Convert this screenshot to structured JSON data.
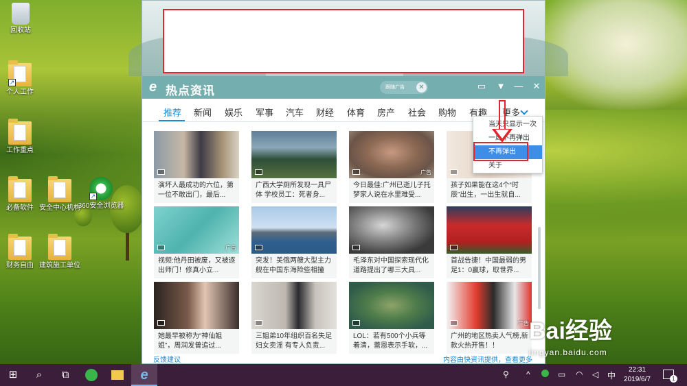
{
  "desktop": {
    "icons": [
      {
        "label": "回收站"
      },
      {
        "label": "个人工作"
      },
      {
        "label": "工作重点"
      },
      {
        "label": "必备软件"
      },
      {
        "label": "安全中心机构"
      },
      {
        "label": "360安全浏览器"
      },
      {
        "label": "财务自由"
      },
      {
        "label": "建筑施工单位"
      }
    ]
  },
  "popup": {
    "app_title": "热点资讯",
    "ad_tag": "跟随广告",
    "window_controls": [
      "monitor-icon",
      "chevron-down-icon",
      "minimize-icon",
      "close-icon"
    ],
    "tabs": [
      "推荐",
      "新闻",
      "娱乐",
      "军事",
      "汽车",
      "财经",
      "体育",
      "房产",
      "社会",
      "购物",
      "有趣",
      "更多"
    ],
    "active_tab": "推荐",
    "cards": [
      {
        "caption": "演坏人最成功的六位，第一位不敢出门，最后...",
        "ad": ""
      },
      {
        "caption": "广西大学厕所发现一具尸体 学校员工：死者身...",
        "ad": ""
      },
      {
        "caption": "今日最佳:广州已逝儿子托梦家人说在水里难受...",
        "ad": "广告"
      },
      {
        "caption": "孩子如果能在这4个“时辰”出生，一出生就自...",
        "ad": ""
      },
      {
        "caption": "视频:他丹田被废，又被逐出师门！修真小立...",
        "ad": "广告"
      },
      {
        "caption": "突发！美俄两艘大型主力舰在中国东海险些相撞",
        "ad": ""
      },
      {
        "caption": "毛泽东对中国探索现代化道路提出了哪三大具...",
        "ad": ""
      },
      {
        "caption": "首战告捷！中国最弱的男足1：0赢球，取世界...",
        "ad": ""
      },
      {
        "caption": "她最早被称为“神仙姐姐”，周润发曾追过...",
        "ad": ""
      },
      {
        "caption": "三姐弟10年组织百名失足妇女卖淫 有专人负责...",
        "ad": ""
      },
      {
        "caption": "LOL：若有500个小兵等着清，蕾恩表示手软，...",
        "ad": ""
      },
      {
        "caption": "广州的地区热卖人气榜,新款火热开售！！",
        "ad": "广告"
      }
    ],
    "footer_left": "反馈建议",
    "footer_right": "内容由快资讯提供，查看更多",
    "menu": [
      "当天只显示一次",
      "一周不再弹出",
      "不再弹出",
      "关于"
    ],
    "menu_selected": "不再弹出",
    "accent": "#1b8ad2",
    "titlebar_color": "#74aeaf",
    "annotation_color": "#e0262a"
  },
  "taskbar": {
    "ime": "中",
    "time": "22:31",
    "date": "2019/6/7",
    "notifications": "1"
  },
  "watermark": {
    "logo": "Bai经验",
    "url": "jingyan.baidu.com"
  }
}
